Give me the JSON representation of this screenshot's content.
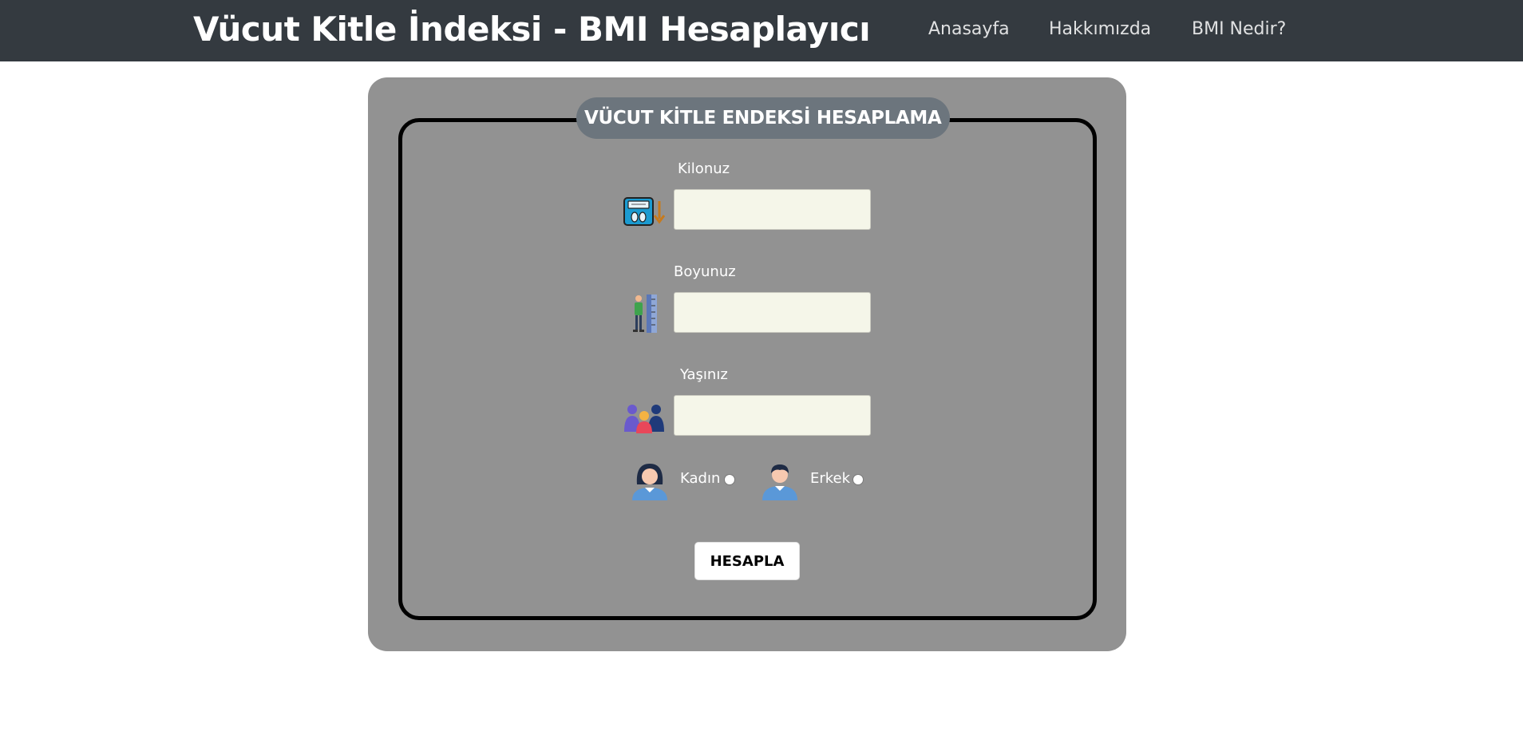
{
  "navbar": {
    "brand": "Vücut Kitle İndeksi - BMI Hesaplayıcı",
    "links": [
      {
        "label": "Anasayfa"
      },
      {
        "label": "Hakkımızda"
      },
      {
        "label": "BMI Nedir?"
      }
    ],
    "background_color": "#343a40"
  },
  "form": {
    "legend": "VÜCUT KİTLE ENDEKSİ HESAPLAMA",
    "fields": {
      "weight": {
        "label": "Kilonuz",
        "value": "",
        "icon": "scale-icon"
      },
      "height": {
        "label": "Boyunuz",
        "value": "",
        "icon": "height-measure-icon"
      },
      "age": {
        "label": "Yaşınız",
        "value": "",
        "icon": "people-group-icon"
      }
    },
    "gender": {
      "options": [
        {
          "label": "Kadın",
          "icon": "woman-avatar-icon",
          "checked": false
        },
        {
          "label": "Erkek",
          "icon": "man-avatar-icon",
          "checked": false
        }
      ]
    },
    "submit_label": "HESAPLA",
    "card_color": "#929292",
    "input_color": "#f5f6e9"
  }
}
